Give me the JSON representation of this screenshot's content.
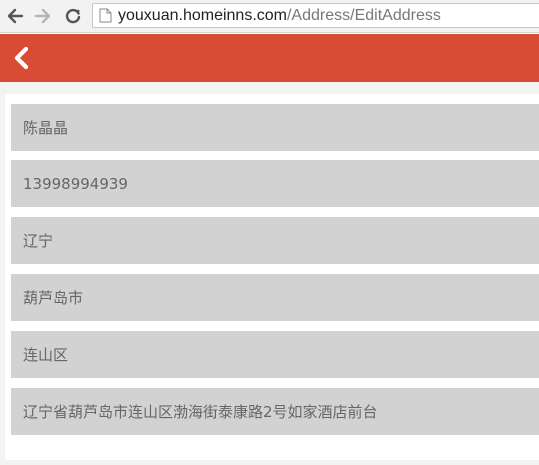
{
  "browser": {
    "url_host": "youxuan.homeinns.com",
    "url_path": "/Address/EditAddress",
    "icons": {
      "back": "arrow-left-icon",
      "forward": "arrow-right-icon",
      "reload": "reload-icon",
      "page": "page-icon"
    }
  },
  "header": {
    "back_icon": "chevron-left-icon",
    "color": "#d84c36"
  },
  "form": {
    "name": "陈晶晶",
    "phone": "13998994939",
    "province": "辽宁",
    "city": "葫芦岛市",
    "district": "连山区",
    "address": "辽宁省葫芦岛市连山区渤海街泰康路2号如家酒店前台"
  }
}
